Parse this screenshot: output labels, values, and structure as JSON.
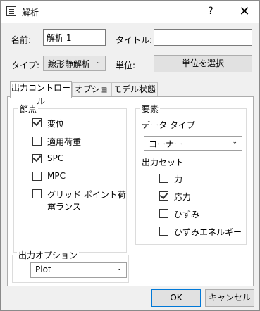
{
  "window": {
    "title": "解析",
    "help": "?",
    "close": "✕"
  },
  "form": {
    "name_label": "名前:",
    "name_value": "解析 1",
    "title_label": "タイトル:",
    "title_value": "",
    "type_label": "タイプ:",
    "type_value": "線形静解析",
    "unit_label": "単位:",
    "unit_button": "単位を選択"
  },
  "tabs": [
    {
      "label": "出力コントロール",
      "active": true
    },
    {
      "label": "オプション",
      "active": false
    },
    {
      "label": "モデル状態",
      "active": false
    }
  ],
  "nodes_group": {
    "title": "節点",
    "items": [
      {
        "label": "変位",
        "checked": true
      },
      {
        "label": "適用荷重",
        "checked": false
      },
      {
        "label": "SPC",
        "checked": true
      },
      {
        "label": "MPC",
        "checked": false
      },
      {
        "label": "グリッド ポイント荷重",
        "label2": "バランス",
        "checked": false
      }
    ]
  },
  "elements_group": {
    "title": "要素",
    "data_type_label": "データ タイプ",
    "data_type_value": "コーナー",
    "output_set_label": "出力セット",
    "items": [
      {
        "label": "力",
        "checked": false
      },
      {
        "label": "応力",
        "checked": true
      },
      {
        "label": "ひずみ",
        "checked": false
      },
      {
        "label": "ひずみエネルギー",
        "checked": false
      }
    ]
  },
  "output_options": {
    "title": "出力オプション",
    "value": "Plot"
  },
  "footer": {
    "ok": "OK",
    "cancel": "キャンセル"
  }
}
